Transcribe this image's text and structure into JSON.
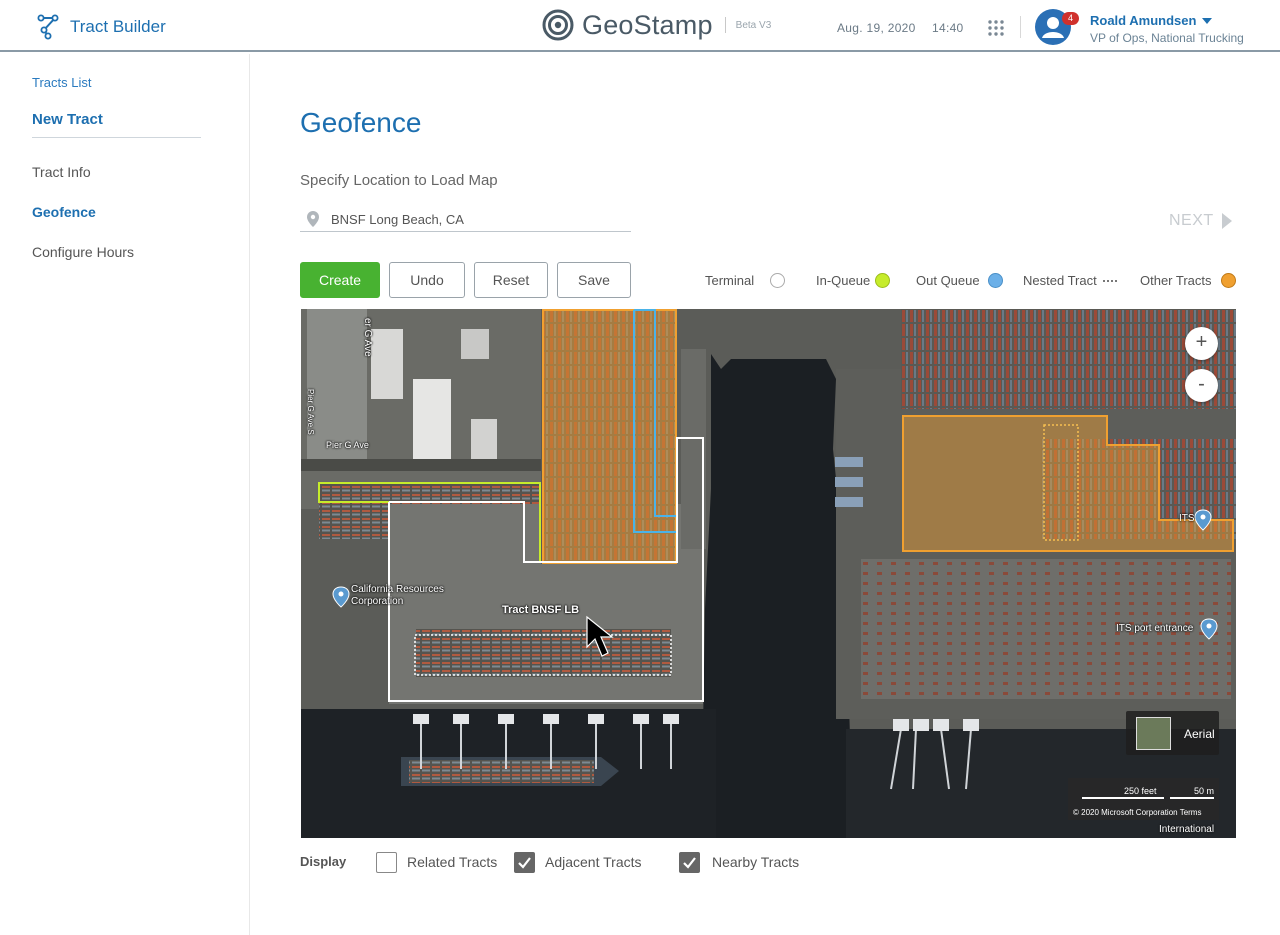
{
  "header": {
    "app_title": "Tract Builder",
    "logo_text": "GeoStamp",
    "logo_badge": "Beta V3",
    "date": "Aug. 19, 2020",
    "time": "14:40",
    "notification_count": "4",
    "user_name": "Roald Amundsen",
    "user_role": "VP of Ops, National Trucking"
  },
  "sidebar": {
    "breadcrumb": "Tracts List",
    "title": "New Tract",
    "items": [
      {
        "label": "Tract Info",
        "active": false
      },
      {
        "label": "Geofence",
        "active": true
      },
      {
        "label": "Configure Hours",
        "active": false
      }
    ]
  },
  "main": {
    "title": "Geofence",
    "subtitle": "Specify Location to Load Map",
    "location_value": "BNSF Long Beach, CA",
    "next_label": "NEXT",
    "buttons": {
      "create": "Create",
      "undo": "Undo",
      "reset": "Reset",
      "save": "Save"
    },
    "legend": {
      "terminal": "Terminal",
      "in_queue": "In-Queue",
      "out_queue": "Out Queue",
      "nested_tract": "Nested Tract",
      "other_tracts": "Other Tracts"
    },
    "colors": {
      "accent": "#1d6fb0",
      "create_button": "#48b231",
      "in_queue": "#c6ec2b",
      "out_queue": "#6cb0e8",
      "other_tracts": "#f0a030",
      "terminal": "#ffffff"
    }
  },
  "map": {
    "labels": {
      "pier_g_ave": "Pier G Ave",
      "pier_g_ave_s": "Pier G Ave S",
      "california": "California Resources",
      "corporation": "Corporation",
      "tract": "Tract BNSF LB",
      "its": "ITS",
      "its_port": "ITS port entrance",
      "aerial": "Aerial",
      "scale_feet": "250 feet",
      "scale_m": "50 m",
      "copyright": "© 2020 Microsoft Corporation  Terms",
      "international": "International",
      "zoom_in": "+",
      "zoom_out": "-"
    }
  },
  "display": {
    "label": "Display",
    "options": [
      {
        "label": "Related Tracts",
        "checked": false
      },
      {
        "label": "Adjacent Tracts",
        "checked": true
      },
      {
        "label": "Nearby Tracts",
        "checked": true
      }
    ]
  }
}
